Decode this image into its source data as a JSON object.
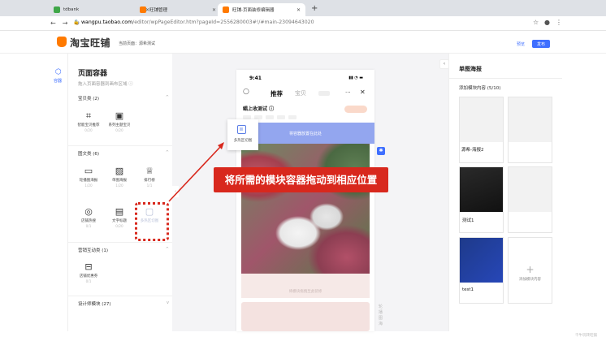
{
  "browser": {
    "tabs": [
      {
        "label": "tdbank",
        "color": "#3fa648"
      },
      {
        "label": "旺铺管理",
        "color": "#ff7a00"
      },
      {
        "label": "旺铺-页面装修编辑器",
        "color": "#ff7a00"
      }
    ],
    "url_domain": "wangpu.taobao.com",
    "url_rest": "/editor/wpPageEditor.htm?pageId=2556280003#!/#main-23094643020"
  },
  "app": {
    "logo_text": "淘宝旺铺",
    "current_page": "当前页面：源希测试",
    "preview_label": "预览",
    "publish_label": "发布"
  },
  "rail": {
    "label": "容器"
  },
  "left_panel": {
    "title": "页面容器",
    "subtitle": "拖入页面容器到画布区域 ⓘ",
    "categories": [
      {
        "name": "宝贝类 (2)",
        "items": [
          {
            "name": "智能宝贝推荐",
            "count": "0/20",
            "icon": "smart-product-icon"
          },
          {
            "name": "系列主题宝贝",
            "count": "0/20",
            "icon": "series-product-icon"
          }
        ]
      },
      {
        "name": "图文类 (6)",
        "items": [
          {
            "name": "轮播图海报",
            "count": "1/20",
            "icon": "carousel-icon"
          },
          {
            "name": "单图海报",
            "count": "1/20",
            "icon": "image-poster-icon"
          },
          {
            "name": "排行榜",
            "count": "1/1",
            "icon": "trophy-icon"
          },
          {
            "name": "店铺热搜",
            "count": "0/1",
            "icon": "search-hot-icon"
          },
          {
            "name": "文字标题",
            "count": "0/20",
            "icon": "text-title-icon"
          },
          {
            "name": "多热区切图",
            "count": "",
            "icon": "hotspot-icon"
          }
        ]
      },
      {
        "name": "营销互动类 (1)",
        "items": [
          {
            "name": "店铺优惠券",
            "count": "0/1",
            "icon": "coupon-icon"
          }
        ]
      },
      {
        "name": "设计师模块 (27)",
        "items": []
      }
    ]
  },
  "phone": {
    "time": "9:41",
    "tab_active": "推荐",
    "tab_other": "宝贝",
    "more": "···",
    "close": "✕",
    "shop_name": "鲳上收测试 ⓘ",
    "drop_hint": "将容器放置在此处",
    "below_hint": "将模块拖拽至此装修",
    "side_label": "轮播图海"
  },
  "drag": {
    "label": "多热区切图"
  },
  "callout": "将所需的模块容器拖动到相应位置",
  "right_panel": {
    "title": "单图海报",
    "subtitle": "添加模块内容 (5/10)",
    "cards": [
      {
        "name": ""
      },
      {
        "name": ""
      },
      {
        "name": "源希-海报2"
      },
      {
        "name": ""
      },
      {
        "name": "测试1"
      },
      {
        "name": ""
      },
      {
        "name": "test1"
      }
    ],
    "add_label": "添加模块内容"
  },
  "watermark": "千牛玩转旺铺"
}
